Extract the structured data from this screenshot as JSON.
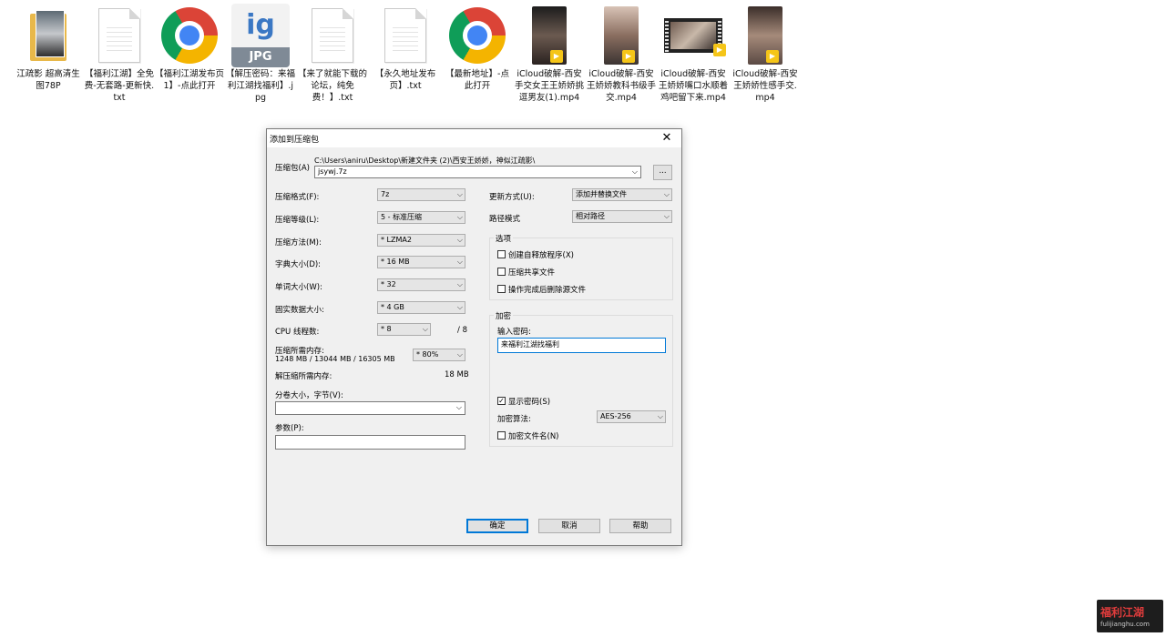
{
  "desktop": {
    "icons": [
      {
        "label": "江疏影 超高清生图78P",
        "kind": "folder"
      },
      {
        "label": "【福利江湖】全免费-无套路-更新快.txt",
        "kind": "txt"
      },
      {
        "label": "【福利江湖发布页1】-点此打开",
        "kind": "chrome"
      },
      {
        "label": "【解压密码：来福利江湖找福利】.jpg",
        "kind": "jpg",
        "badge": "JPG",
        "logo": "ig"
      },
      {
        "label": "【来了就能下载的论坛，纯免费！】.txt",
        "kind": "txt"
      },
      {
        "label": "【永久地址发布页】.txt",
        "kind": "txt"
      },
      {
        "label": "【最新地址】-点此打开",
        "kind": "chrome"
      },
      {
        "label": "iCloud破解-西安手交女王王娇娇挑逗男友(1).mp4",
        "kind": "video"
      },
      {
        "label": "iCloud破解-西安王娇娇教科书级手交.mp4",
        "kind": "video"
      },
      {
        "label": "iCloud破解-西安王娇娇嘴口水顺着鸡吧留下来.mp4",
        "kind": "film"
      },
      {
        "label": "iCloud破解-西安王娇娇性感手交.mp4",
        "kind": "video"
      }
    ]
  },
  "dialog": {
    "title": "添加到压缩包",
    "close_glyph": "✕",
    "archive_label": "压缩包(A)",
    "archive_path": "C:\\Users\\aniru\\Desktop\\新建文件夹 (2)\\西安王娇娇，神似江疏影\\",
    "archive_name": "jsywj.7z",
    "browse_label": "...",
    "left": {
      "format": {
        "label": "压缩格式(F):",
        "value": "7z"
      },
      "level": {
        "label": "压缩等级(L):",
        "value": "5 - 标准压缩"
      },
      "method": {
        "label": "压缩方法(M):",
        "value": "* LZMA2"
      },
      "dict": {
        "label": "字典大小(D):",
        "value": "* 16 MB"
      },
      "word": {
        "label": "单词大小(W):",
        "value": "* 32"
      },
      "solid": {
        "label": "固实数据大小:",
        "value": "* 4 GB"
      },
      "threads": {
        "label": "CPU 线程数:",
        "value": "* 8",
        "suffix": "/ 8"
      },
      "mem_compress": {
        "label": "压缩所需内存:",
        "detail": "1248 MB / 13044 MB / 16305 MB",
        "value": "* 80%"
      },
      "mem_decompress": {
        "label": "解压缩所需内存:",
        "value": "18 MB"
      },
      "volume": {
        "label": "分卷大小，字节(V):",
        "value": ""
      },
      "params": {
        "label": "参数(P):",
        "value": ""
      }
    },
    "right": {
      "update": {
        "label": "更新方式(U):",
        "value": "添加并替换文件"
      },
      "path_mode": {
        "label": "路径模式",
        "value": "相对路径"
      },
      "options": {
        "title": "选项",
        "sfx": "创建自释放程序(X)",
        "shared": "压缩共享文件",
        "delete": "操作完成后删除源文件"
      },
      "encryption": {
        "title": "加密",
        "password_label": "输入密码:",
        "password_value": "来福利江湖找福利",
        "show_password": "显示密码(S)",
        "method_label": "加密算法:",
        "method_value": "AES-256",
        "encrypt_names": "加密文件名(N)"
      }
    },
    "buttons": {
      "ok": "确定",
      "cancel": "取消",
      "help": "帮助"
    }
  },
  "watermark": {
    "main": "福利江湖",
    "sub": "fulijianghu.com"
  }
}
